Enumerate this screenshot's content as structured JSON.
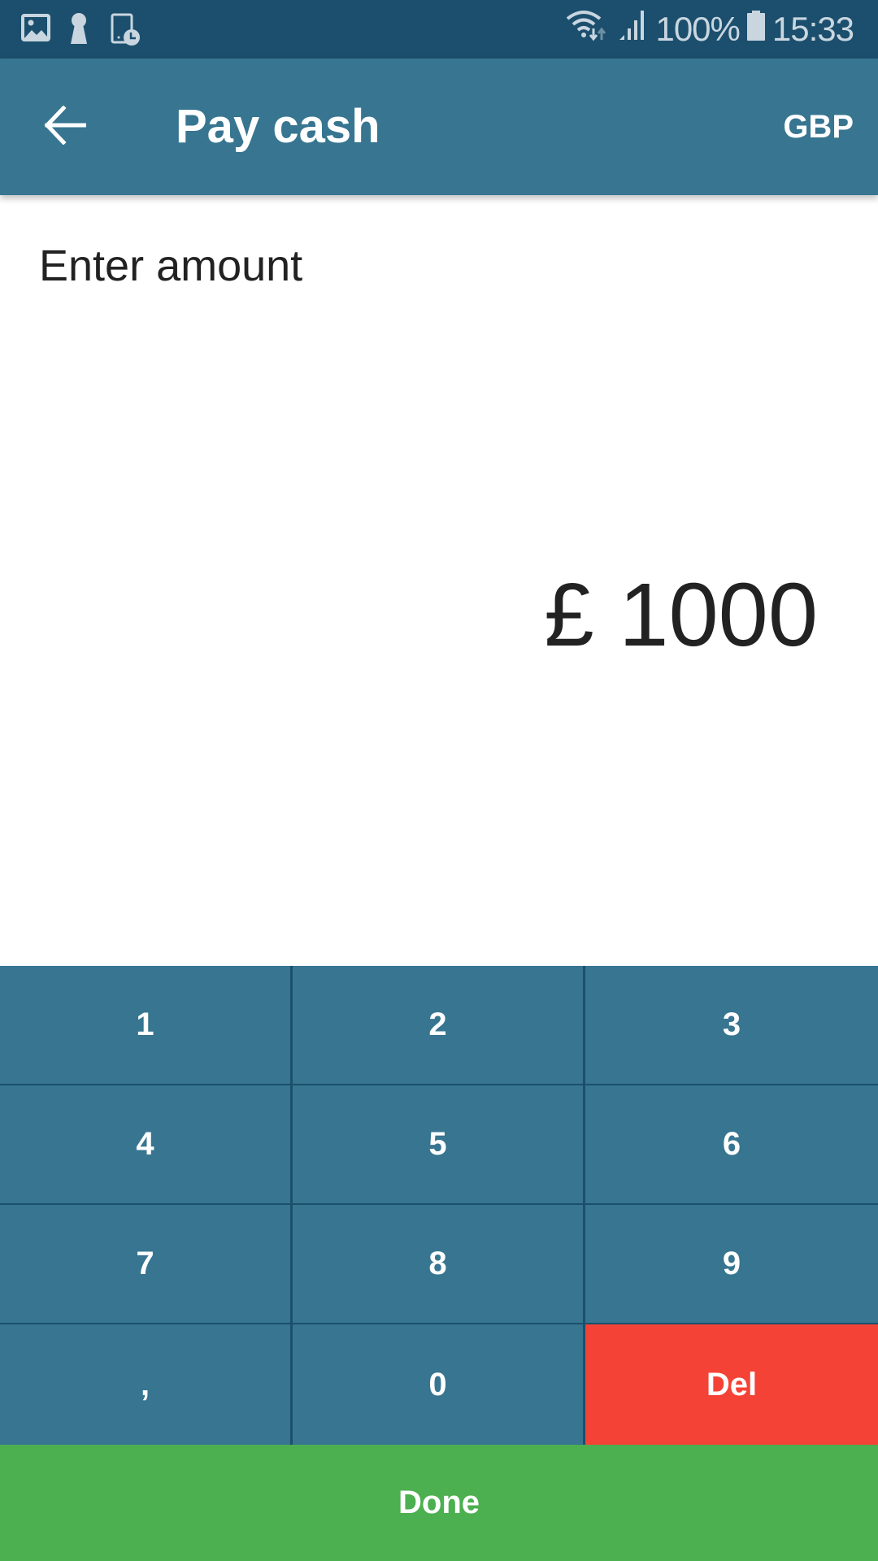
{
  "status_bar": {
    "left_icons": [
      "gallery-icon",
      "keyhole-icon",
      "tablet-clock-icon"
    ],
    "right_icons": [
      "wifi-icon",
      "signal-icon",
      "battery-icon"
    ],
    "battery": "100%",
    "time": "15:33"
  },
  "app_bar": {
    "back_icon": "arrow-left-icon",
    "title": "Pay cash",
    "currency": "GBP"
  },
  "main": {
    "prompt": "Enter amount",
    "amount": "£ 1000"
  },
  "keypad": {
    "keys": [
      {
        "label": "1"
      },
      {
        "label": "2"
      },
      {
        "label": "3"
      },
      {
        "label": "4"
      },
      {
        "label": "5"
      },
      {
        "label": "6"
      },
      {
        "label": "7"
      },
      {
        "label": "8"
      },
      {
        "label": "9"
      },
      {
        "label": ","
      },
      {
        "label": "0"
      },
      {
        "label": "Del"
      }
    ],
    "done_label": "Done"
  },
  "colors": {
    "status_bar": "#1b4f6d",
    "primary": "#377590",
    "key_border": "#1c4f6c",
    "delete": "#f44336",
    "done": "#4caf50"
  }
}
